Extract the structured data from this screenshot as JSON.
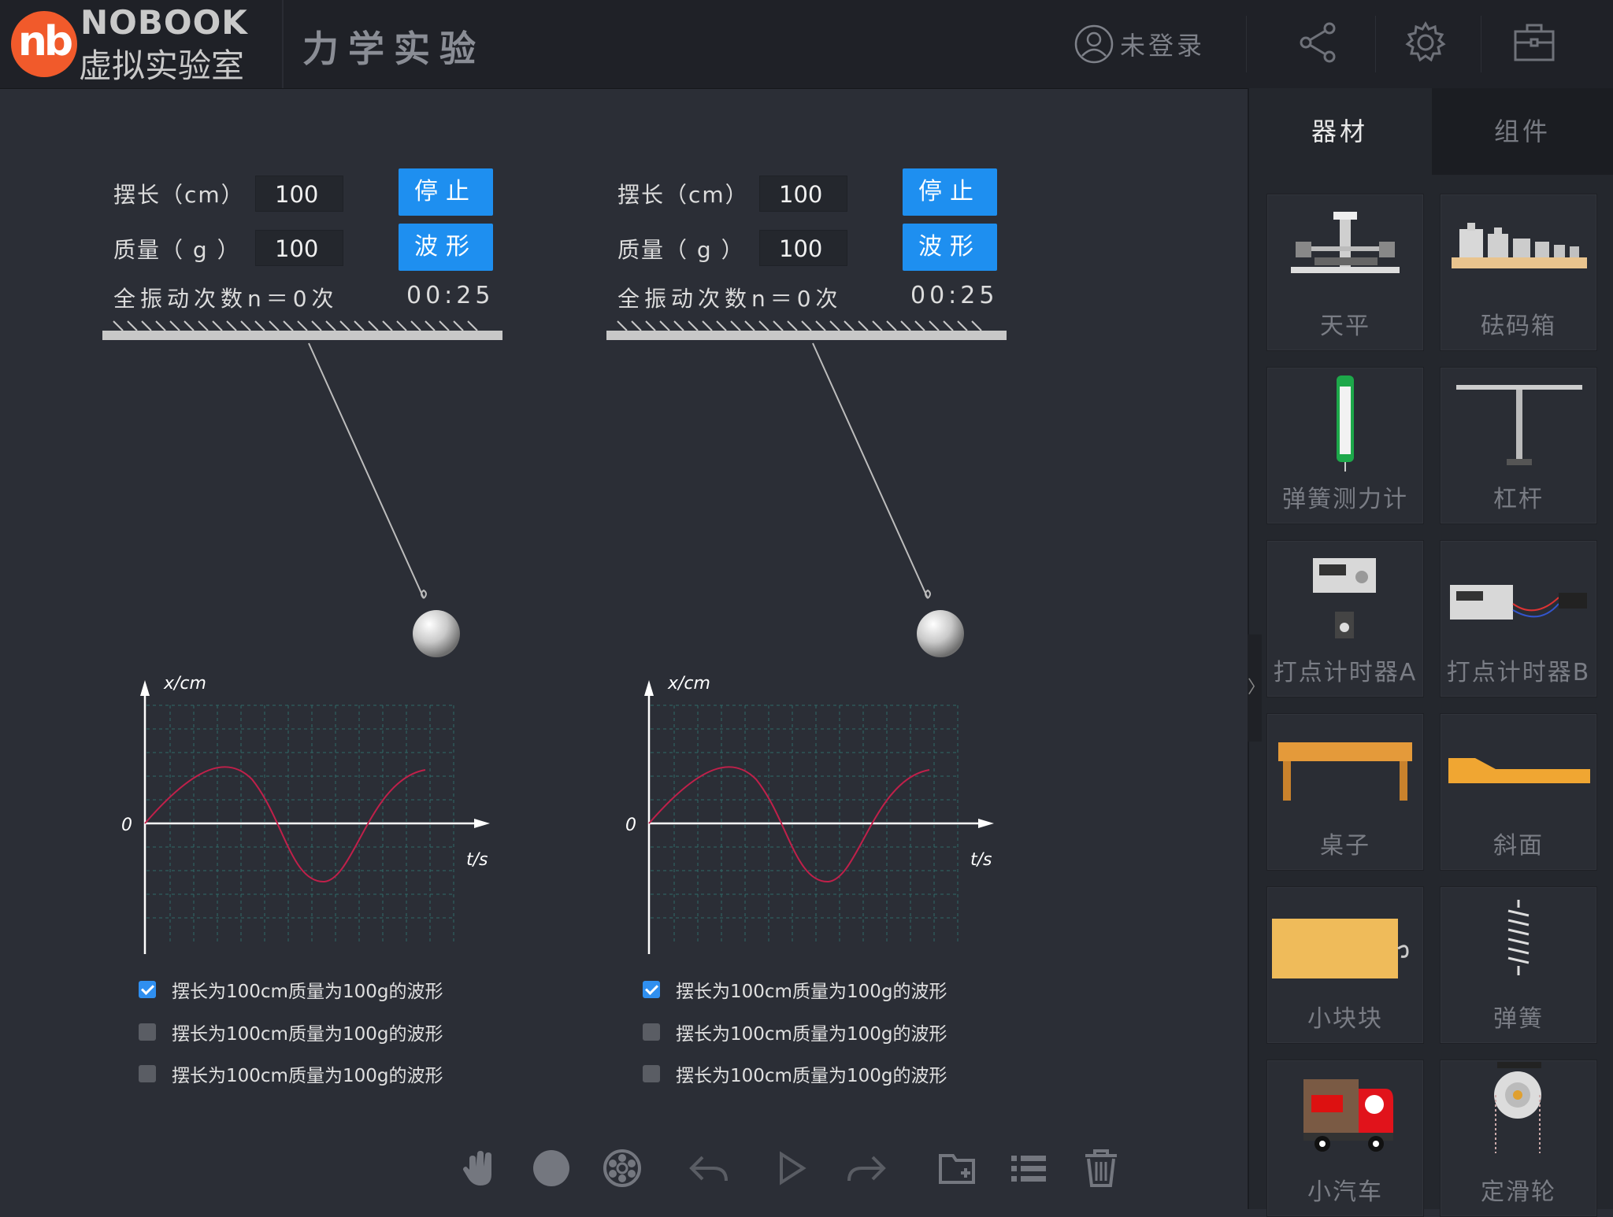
{
  "header": {
    "logo_mark": "nb",
    "logo_en": "NOBOOK",
    "logo_cn": "虚拟实验室",
    "title": "力学实验",
    "login_label": "未登录",
    "icons": [
      "share-icon",
      "gear-icon",
      "toolbox-icon"
    ]
  },
  "panels": [
    {
      "length_label": "摆长（cm）",
      "length_value": "100",
      "mass_label": "质量（ g ）",
      "mass_value": "100",
      "stop_label": "停止",
      "wave_label": "波形",
      "count_label": "全振动次数n＝0次",
      "timer": "00:25",
      "graph": {
        "y_label": "x/cm",
        "x_label": "t/s",
        "origin": "0"
      },
      "checks": [
        {
          "label": "摆长为100cm质量为100g的波形",
          "checked": true
        },
        {
          "label": "摆长为100cm质量为100g的波形",
          "checked": false
        },
        {
          "label": "摆长为100cm质量为100g的波形",
          "checked": false
        }
      ]
    },
    {
      "length_label": "摆长（cm）",
      "length_value": "100",
      "mass_label": "质量（ g ）",
      "mass_value": "100",
      "stop_label": "停止",
      "wave_label": "波形",
      "count_label": "全振动次数n＝0次",
      "timer": "00:25",
      "graph": {
        "y_label": "x/cm",
        "x_label": "t/s",
        "origin": "0"
      },
      "checks": [
        {
          "label": "摆长为100cm质量为100g的波形",
          "checked": true
        },
        {
          "label": "摆长为100cm质量为100g的波形",
          "checked": false
        },
        {
          "label": "摆长为100cm质量为100g的波形",
          "checked": false
        }
      ]
    }
  ],
  "sidebar": {
    "tabs": [
      {
        "label": "器材",
        "active": true
      },
      {
        "label": "组件",
        "active": false
      }
    ],
    "items": [
      {
        "label": "天平",
        "icon": "balance-icon"
      },
      {
        "label": "砝码箱",
        "icon": "weight-box-icon"
      },
      {
        "label": "弹簧测力计",
        "icon": "spring-scale-icon"
      },
      {
        "label": "杠杆",
        "icon": "lever-icon"
      },
      {
        "label": "打点计时器A",
        "icon": "ticker-timer-a-icon"
      },
      {
        "label": "打点计时器B",
        "icon": "ticker-timer-b-icon"
      },
      {
        "label": "桌子",
        "icon": "table-icon"
      },
      {
        "label": "斜面",
        "icon": "incline-icon"
      },
      {
        "label": "小块块",
        "icon": "block-icon"
      },
      {
        "label": "弹簧",
        "icon": "spring-icon"
      },
      {
        "label": "小汽车",
        "icon": "toy-car-icon"
      },
      {
        "label": "定滑轮",
        "icon": "pulley-icon"
      }
    ],
    "expand_handle": "〉"
  },
  "toolbar": {
    "tools": [
      "hand-icon",
      "circle-icon",
      "wheel-icon",
      "undo-icon",
      "play-icon",
      "redo-icon",
      "folder-icon",
      "list-icon",
      "trash-icon"
    ]
  },
  "colors": {
    "accent_blue": "#1e8ff0",
    "logo_orange": "#f15a2b",
    "wave_color": "#c0204a",
    "background": "#2b2e36"
  }
}
